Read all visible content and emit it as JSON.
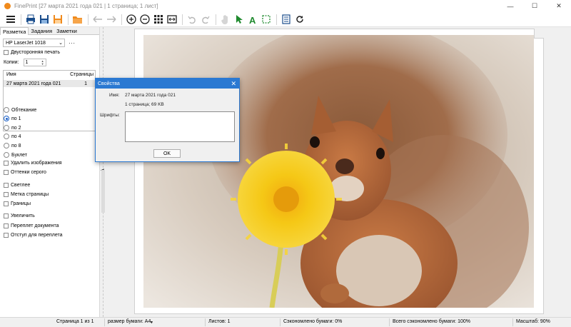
{
  "window": {
    "title": "FinePrint [27 марта 2021 года 021 | 1 страница; 1 лист]",
    "controls": {
      "minimize": "—",
      "maximize": "☐",
      "close": "✕"
    }
  },
  "toolbar": {
    "icons": [
      "menu-icon",
      "print-icon",
      "save-icon",
      "save-as-icon",
      "open-folder-icon",
      "back-icon",
      "forward-icon",
      "zoom-in-icon",
      "zoom-out-icon",
      "grid-icon",
      "fit-icon",
      "undo-icon",
      "redo-icon",
      "hand-icon",
      "select-arrow-icon",
      "text-icon",
      "select-rect-icon",
      "properties-icon",
      "refresh-icon"
    ]
  },
  "sidebar": {
    "tabs": [
      "Разметка",
      "Задания",
      "Заметки"
    ],
    "active_tab": "Разметка",
    "printer": "HP LaserJet 1018",
    "more": "···",
    "duplex_label": "Двусторонняя печать",
    "copies_label": "Копии:",
    "copies_value": "1",
    "jobs": {
      "headers": {
        "name": "Имя",
        "pages": "Страницы"
      },
      "rows": [
        {
          "name": "27 марта 2021 года 021",
          "pages": "1"
        }
      ]
    },
    "layout_options": [
      {
        "label": "Обтекание",
        "checked": false
      },
      {
        "label": "по 1",
        "checked": true
      },
      {
        "label": "по 2",
        "checked": false
      },
      {
        "label": "по 4",
        "checked": false
      },
      {
        "label": "по 8",
        "checked": false
      },
      {
        "label": "Буклет",
        "checked": false
      }
    ],
    "checkboxes": [
      "Удалить изображения",
      "Оттенки серого",
      "Светлее",
      "Метка страницы",
      "Границы",
      "Увеличить",
      "Переплет документа",
      "Отступ для переплета"
    ]
  },
  "dialog": {
    "title": "Свойства",
    "name_label": "Имя:",
    "name_value": "27 марта 2021 года 021",
    "info": "1 страница; 69 KB",
    "fonts_label": "Шрифты:",
    "ok": "OK"
  },
  "statusbar": {
    "page": "Страница 1 из 1",
    "paper_size": "размер бумаги: A4",
    "sheets": "Листов: 1",
    "saved": "Сэкономлено бумаги: 0%",
    "total_saved": "Всего сэкономлено бумаги: 100%",
    "zoom": "Масштаб: 90%"
  },
  "colors": {
    "accent": "#2b79d2",
    "app_icon": "#f08a1c",
    "flower": "#f5c816",
    "squirrel": "#b8683a"
  }
}
